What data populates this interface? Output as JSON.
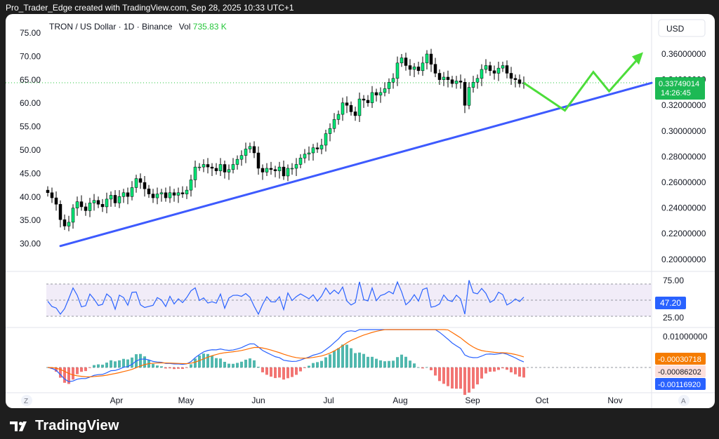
{
  "header": {
    "text": "Pro_Trader_Edge created with TradingView.com, Sep 28, 2025 10:33 UTC+1"
  },
  "footer": {
    "brand": "TradingView"
  },
  "chart_data": {
    "type": "candlestick",
    "symbol_line": {
      "symbol": "TRON / US Dollar · 1D · Binance",
      "vol_label": "Vol",
      "vol_value": "735.83 K"
    },
    "currency_button": "USD",
    "x_ticks": [
      "Apr",
      "May",
      "Jun",
      "Jul",
      "Aug",
      "Sep",
      "Oct",
      "Nov"
    ],
    "left_axis": {
      "ticks": [
        "75.00",
        "70.00",
        "65.00",
        "60.00",
        "55.00",
        "50.00",
        "45.00",
        "40.00",
        "35.00",
        "30.00"
      ],
      "range": [
        30,
        75
      ]
    },
    "right_axis": {
      "ticks": [
        "0.36000000",
        "0.34000000",
        "0.32000000",
        "0.30000000",
        "0.28000000",
        "0.26000000",
        "0.24000000",
        "0.22000000",
        "0.20000000"
      ],
      "range": [
        0.2,
        0.36
      ]
    },
    "last_price": {
      "value": "0.33749014",
      "countdown": "14:26:45"
    },
    "close_series": [
      0.252,
      0.248,
      0.243,
      0.231,
      0.226,
      0.229,
      0.24,
      0.245,
      0.241,
      0.238,
      0.244,
      0.246,
      0.243,
      0.241,
      0.247,
      0.25,
      0.244,
      0.249,
      0.252,
      0.249,
      0.256,
      0.263,
      0.26,
      0.255,
      0.251,
      0.248,
      0.251,
      0.252,
      0.248,
      0.252,
      0.25,
      0.252,
      0.251,
      0.254,
      0.262,
      0.272,
      0.272,
      0.274,
      0.272,
      0.271,
      0.269,
      0.274,
      0.268,
      0.27,
      0.274,
      0.278,
      0.281,
      0.286,
      0.288,
      0.283,
      0.271,
      0.268,
      0.271,
      0.27,
      0.269,
      0.272,
      0.265,
      0.271,
      0.271,
      0.274,
      0.279,
      0.282,
      0.283,
      0.287,
      0.286,
      0.289,
      0.298,
      0.302,
      0.309,
      0.313,
      0.322,
      0.32,
      0.315,
      0.312,
      0.325,
      0.324,
      0.322,
      0.33,
      0.328,
      0.33,
      0.333,
      0.338,
      0.341,
      0.353,
      0.357,
      0.351,
      0.348,
      0.35,
      0.347,
      0.353,
      0.36,
      0.352,
      0.345,
      0.34,
      0.342,
      0.34,
      0.337,
      0.339,
      0.338,
      0.32,
      0.334,
      0.338,
      0.341,
      0.348,
      0.351,
      0.347,
      0.345,
      0.349,
      0.351,
      0.345,
      0.341,
      0.34,
      0.337,
      0.3375
    ],
    "projection_path": [
      [
        0.3375,
        0
      ],
      [
        0.316,
        13
      ],
      [
        0.346,
        22
      ],
      [
        0.331,
        27
      ],
      [
        0.356,
        36
      ]
    ],
    "trendline": {
      "from": {
        "price": 0.2105,
        "index": 3
      },
      "to": {
        "price": 0.3375,
        "index": 160
      }
    },
    "rsi": {
      "ticks": [
        "75.00",
        "25.00"
      ],
      "current": "47.20",
      "band": [
        30,
        70
      ]
    },
    "macd": {
      "tick": "0.01000000",
      "values": [
        "-0.00030718",
        "-0.00086202",
        "-0.00116920"
      ],
      "line_color": "#2962ff",
      "signal_color": "#ff6d00",
      "hist_up": "#26a69a",
      "hist_down": "#ef5350"
    },
    "colors": {
      "candle_up": "#00e676",
      "candle_down": "#000000",
      "trendline": "#3d5afe",
      "projection": "#4cdd3a",
      "label_green": "#1db954",
      "label_orange": "#f57c00",
      "label_blue": "#2962ff"
    },
    "bottom_buttons": {
      "left": "Z",
      "right": "A"
    }
  }
}
